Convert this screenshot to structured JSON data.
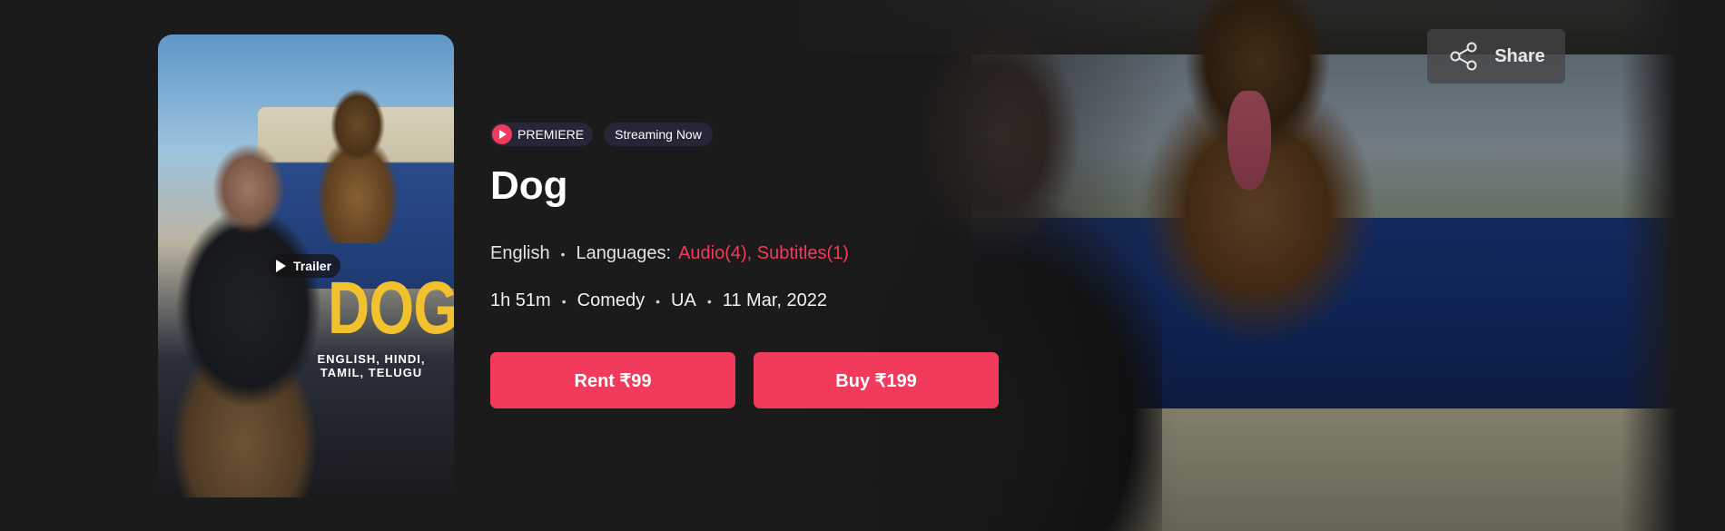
{
  "movie": {
    "title": "Dog",
    "poster": {
      "title_art": "DOG",
      "languages_art": "ENGLISH, HINDI, TAMIL, TELUGU"
    },
    "trailer_label": "Trailer",
    "badges": {
      "premiere": "PREMIERE",
      "status": "Streaming Now"
    },
    "language": "English",
    "languages_label": "Languages:",
    "languages_value": "Audio(4), Subtitles(1)",
    "duration": "1h 51m",
    "genre": "Comedy",
    "rating": "UA",
    "release_date": "11 Mar, 2022"
  },
  "actions": {
    "rent_label": "Rent ₹99",
    "buy_label": "Buy ₹199",
    "share_label": "Share"
  },
  "colors": {
    "accent": "#f23b5c",
    "background": "#1b1b1b",
    "badge_bg": "#262638"
  },
  "icons": {
    "premiere": "premiere-play-icon",
    "trailer": "play-icon",
    "share": "share-icon"
  }
}
